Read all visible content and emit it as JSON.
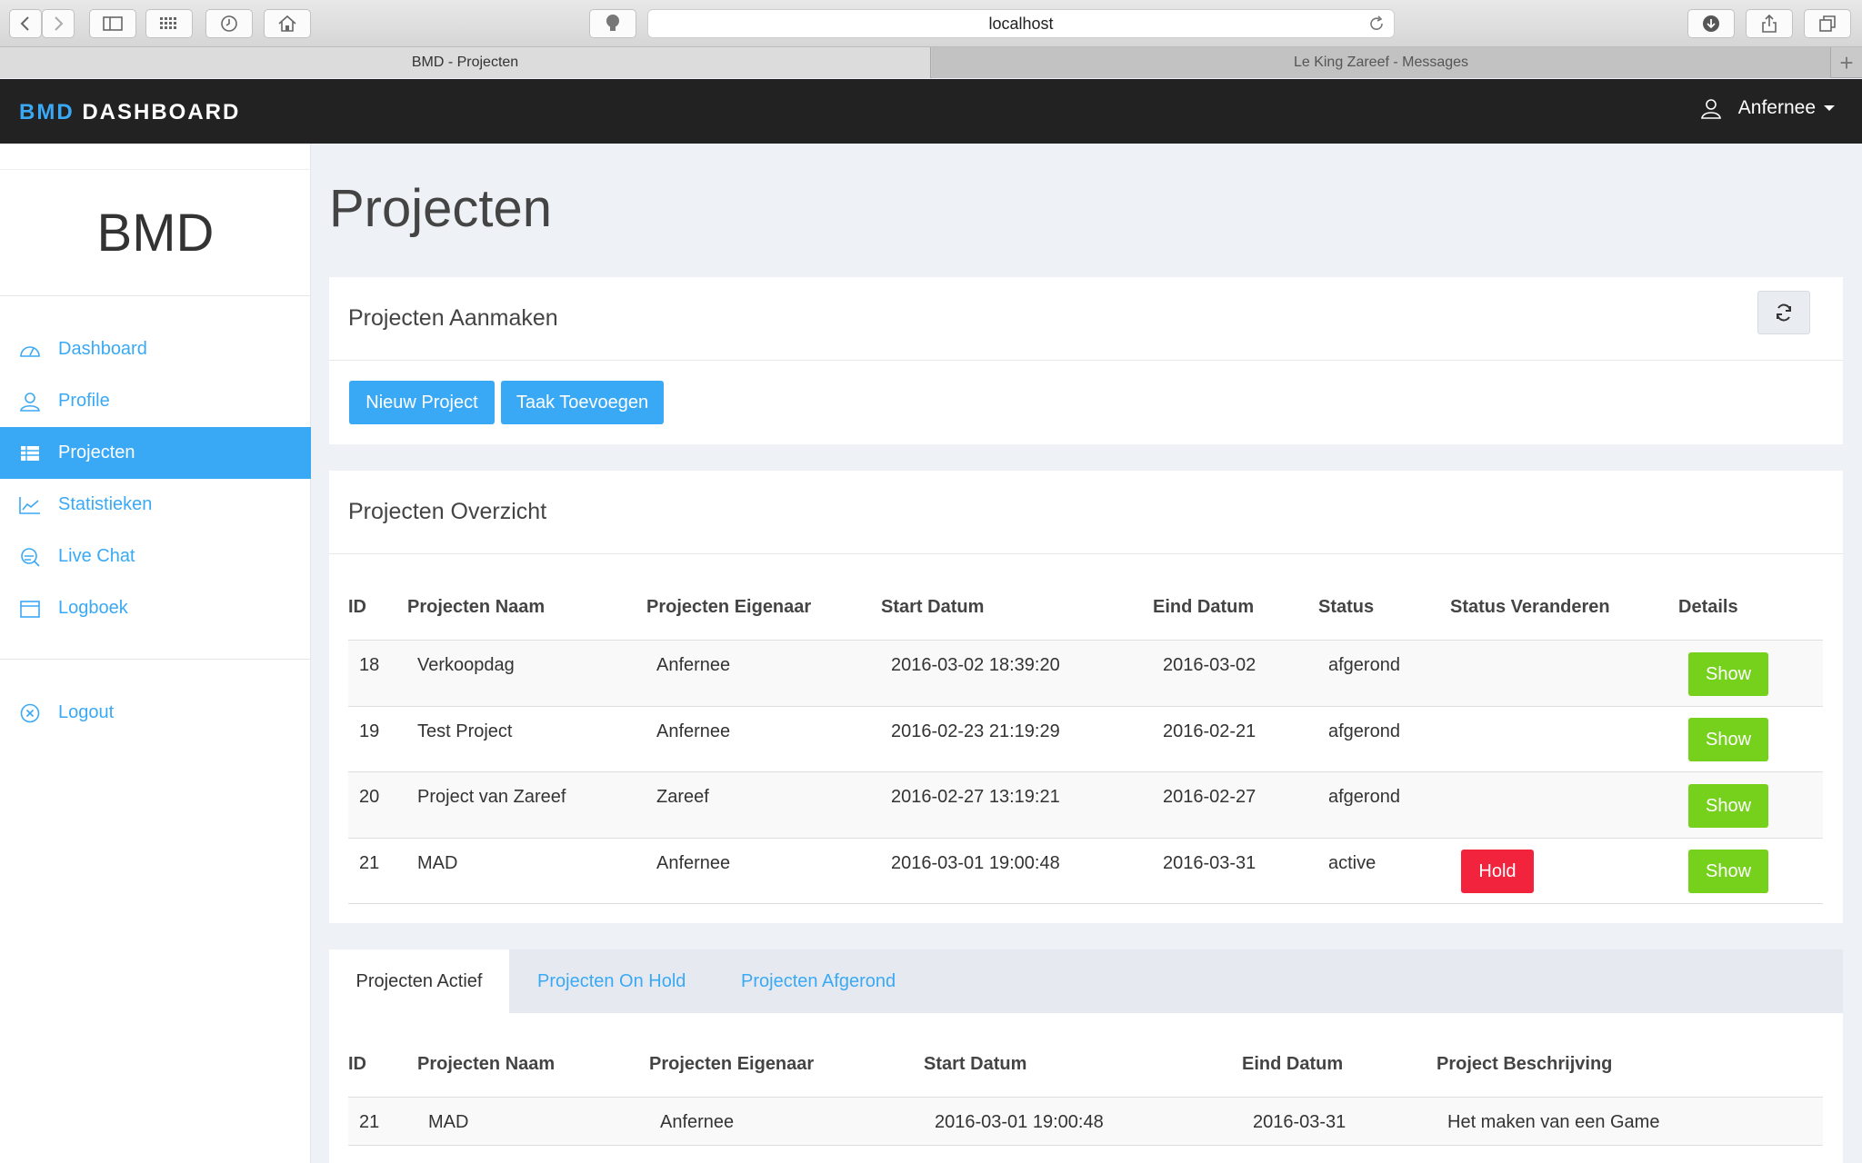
{
  "browser": {
    "url": "localhost",
    "tabs": [
      {
        "title": "BMD - Projecten"
      },
      {
        "title": "Le King Zareef - Messages"
      }
    ],
    "new_tab_glyph": "+"
  },
  "header": {
    "brand_part1": "BMD",
    "brand_part2": " DASHBOARD",
    "user_name": "Anfernee"
  },
  "sidebar": {
    "logo": "BMD",
    "items": [
      {
        "label": "Dashboard",
        "icon": "dashboard-icon"
      },
      {
        "label": "Profile",
        "icon": "user-icon"
      },
      {
        "label": "Projecten",
        "icon": "table-icon",
        "active": true
      },
      {
        "label": "Statistieken",
        "icon": "chart-line-icon"
      },
      {
        "label": "Live Chat",
        "icon": "chat-icon"
      },
      {
        "label": "Logboek",
        "icon": "calendar-icon"
      }
    ],
    "logout": "Logout"
  },
  "main": {
    "title": "Projecten",
    "create_panel": {
      "title": "Projecten Aanmaken",
      "new_project": "Nieuw Project",
      "add_task": "Taak Toevoegen"
    },
    "overview": {
      "title": "Projecten Overzicht",
      "columns": [
        "ID",
        "Projecten Naam",
        "Projecten Eigenaar",
        "Start Datum",
        "Eind Datum",
        "Status",
        "Status Veranderen",
        "Details"
      ],
      "rows": [
        {
          "id": "18",
          "name": "Verkoopdag",
          "owner": "Anfernee",
          "start": "2016-03-02 18:39:20",
          "end": "2016-03-02",
          "status": "afgerond",
          "action": "",
          "details": "Show"
        },
        {
          "id": "19",
          "name": "Test Project",
          "owner": "Anfernee",
          "start": "2016-02-23 21:19:29",
          "end": "2016-02-21",
          "status": "afgerond",
          "action": "",
          "details": "Show"
        },
        {
          "id": "20",
          "name": "Project van Zareef",
          "owner": "Zareef",
          "start": "2016-02-27 13:19:21",
          "end": "2016-02-27",
          "status": "afgerond",
          "action": "",
          "details": "Show"
        },
        {
          "id": "21",
          "name": "MAD",
          "owner": "Anfernee",
          "start": "2016-03-01 19:00:48",
          "end": "2016-03-31",
          "status": "active",
          "action": "Hold",
          "details": "Show"
        }
      ],
      "colors": {
        "show": "#76d11c",
        "hold": "#f2233d"
      }
    },
    "status_tabs": {
      "tabs": [
        "Projecten Actief",
        "Projecten On Hold",
        "Projecten Afgerond"
      ],
      "columns": [
        "ID",
        "Projecten Naam",
        "Projecten Eigenaar",
        "Start Datum",
        "Eind Datum",
        "Project Beschrijving"
      ],
      "rows": [
        {
          "id": "21",
          "name": "MAD",
          "owner": "Anfernee",
          "start": "2016-03-01 19:00:48",
          "end": "2016-03-31",
          "description": "Het maken van een Game"
        }
      ]
    }
  },
  "colors": {
    "accent": "#3aa9f5",
    "header_bg": "#222222"
  }
}
